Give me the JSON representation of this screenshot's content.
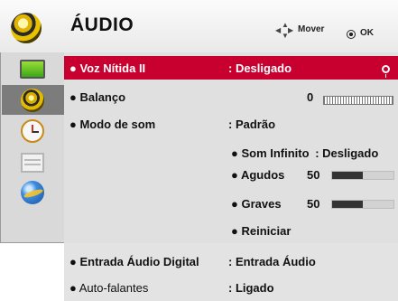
{
  "header": {
    "title": "ÁUDIO",
    "icon": "speaker-icon",
    "move_label": "Mover",
    "ok_label": "OK"
  },
  "sidebar": {
    "items": [
      {
        "name": "picture",
        "icon": "tv-picture-icon",
        "active": false
      },
      {
        "name": "audio",
        "icon": "speaker-icon",
        "active": true
      },
      {
        "name": "time",
        "icon": "clock-icon",
        "active": false
      },
      {
        "name": "option",
        "icon": "option-icon",
        "active": false
      },
      {
        "name": "network",
        "icon": "globe-icon",
        "active": false
      }
    ]
  },
  "menu": {
    "voz_nitida": {
      "label": "● Voz Nítida II",
      "value": ": Desligado"
    },
    "balanco": {
      "label": "● Balanço",
      "value": "0"
    },
    "modo_som": {
      "label": "● Modo de som",
      "value": ": Padrão"
    },
    "som_infinito": {
      "label": "● Som Infinito",
      "value": ": Desligado"
    },
    "agudos": {
      "label": "● Agudos",
      "value": "50",
      "level": 0.5
    },
    "graves": {
      "label": "● Graves",
      "value": "50",
      "level": 0.5
    },
    "reiniciar": {
      "label": "● Reiniciar"
    },
    "entrada_audio": {
      "label": "● Entrada Áudio Digital",
      "value": ": Entrada Áudio"
    },
    "auto_falantes": {
      "label": "● Auto-falantes",
      "value": ": Ligado"
    }
  },
  "colors": {
    "selection": "#c8002f",
    "panel": "#e0e0e0",
    "sidebar": "#d9d9d9"
  }
}
